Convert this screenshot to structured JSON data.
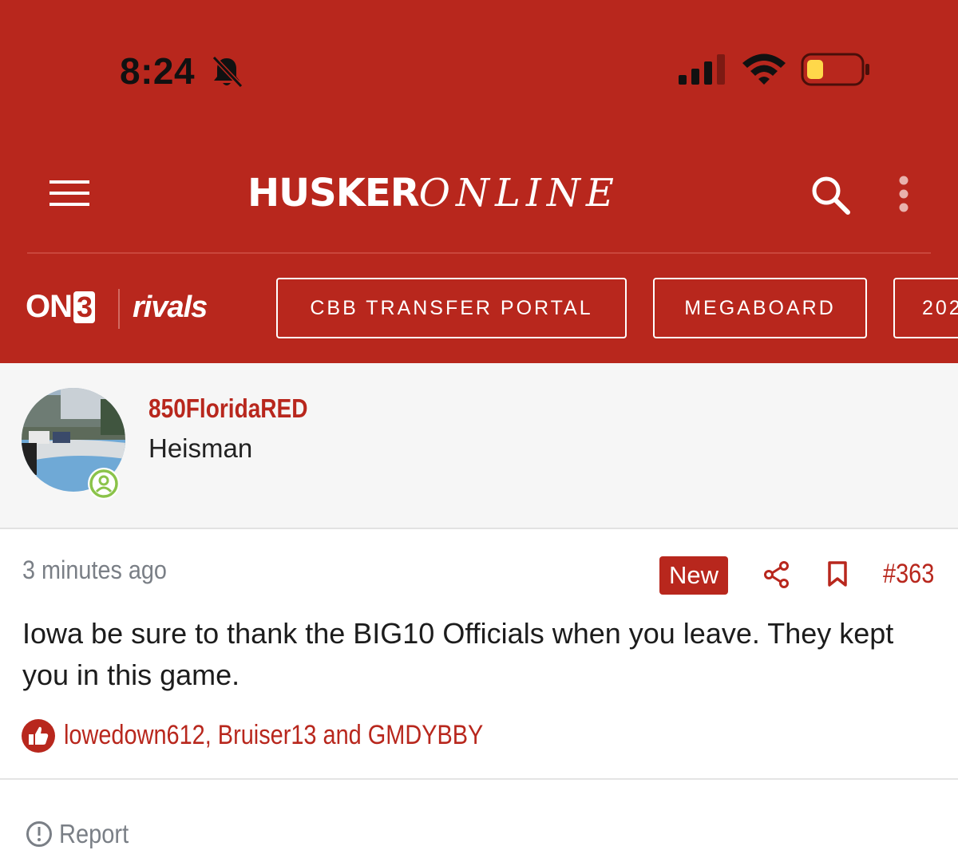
{
  "status_bar": {
    "time": "8:24",
    "icons": [
      "bell-slash-icon",
      "signal-icon",
      "wifi-icon",
      "battery-icon"
    ]
  },
  "nav": {
    "logo_bold": "HUSKER",
    "logo_thin": "ONLINE",
    "icons": [
      "menu-icon",
      "search-icon",
      "more-vertical-icon"
    ]
  },
  "brands": {
    "on3_prefix": "ON",
    "on3_number": "3",
    "rivals": "rivals"
  },
  "pills": [
    {
      "label": "CBB TRANSFER PORTAL"
    },
    {
      "label": "MEGABOARD"
    },
    {
      "label": "202"
    }
  ],
  "user": {
    "username": "850FloridaRED",
    "title": "Heisman"
  },
  "post": {
    "timestamp": "3 minutes ago",
    "badge": "New",
    "number": "#363",
    "body": "Iowa be sure to thank the BIG10 Officials when you leave. They kept you in this game.",
    "reactions": "lowedown612, Bruiser13 and GMDYBBY",
    "report_label": "Report"
  },
  "colors": {
    "brand_red": "#b8271d",
    "muted_gray": "#7a7f86",
    "online_green": "#8bc34a"
  }
}
